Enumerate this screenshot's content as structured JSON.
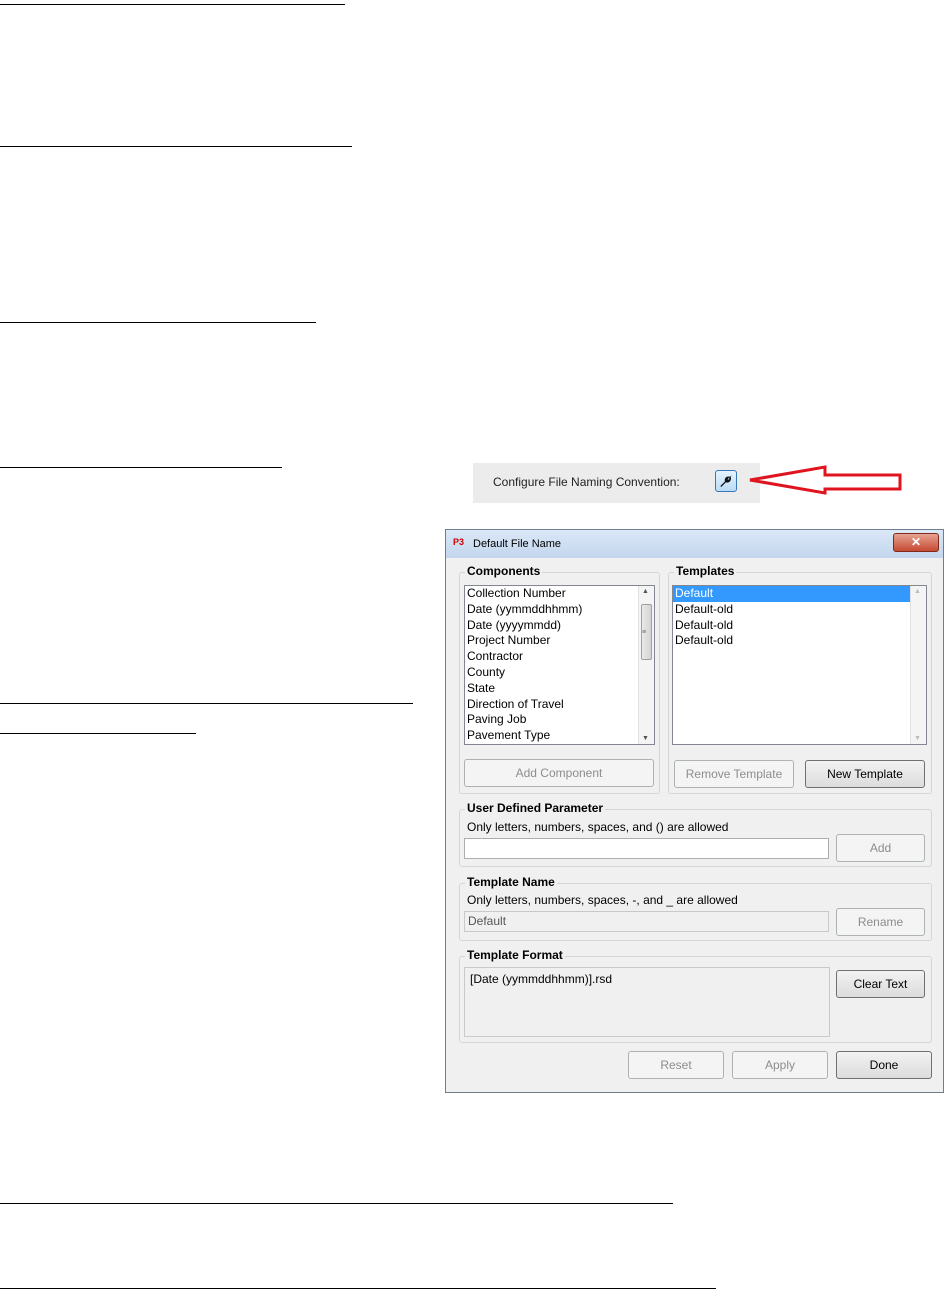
{
  "config": {
    "label": "Configure File Naming Convention:",
    "button_icon": "wrench-icon",
    "arrow_color": "#e0141e"
  },
  "dialog": {
    "title": "Default File Name",
    "app_icon_text": "P3",
    "close_glyph": "✕",
    "components": {
      "title": "Components",
      "items": [
        "Collection Number",
        "Date (yymmddhhmm)",
        "Date (yyyymmdd)",
        "Project Number",
        "Contractor",
        "County",
        "State",
        "Direction of Travel",
        "Paving Job",
        "Pavement Type"
      ],
      "add_button": "Add Component"
    },
    "templates": {
      "title": "Templates",
      "items": [
        "Default",
        "Default-old",
        "Default-old",
        "Default-old"
      ],
      "selected": "Default",
      "remove_button": "Remove Template",
      "new_button": "New Template"
    },
    "user_param": {
      "title": "User Defined Parameter",
      "hint": "Only letters, numbers, spaces, and () are allowed",
      "value": "",
      "add_button": "Add"
    },
    "template_name": {
      "title": "Template Name",
      "hint": "Only letters, numbers, spaces, -, and _ are allowed",
      "value": "Default",
      "rename_button": "Rename"
    },
    "template_format": {
      "title": "Template Format",
      "value": "[Date (yymmddhhmm)].rsd",
      "clear_button": "Clear Text"
    },
    "footer": {
      "reset_button": "Reset",
      "apply_button": "Apply",
      "done_button": "Done"
    }
  },
  "colors": {
    "selection": "#3399ff",
    "close_button": "#c74a33"
  }
}
